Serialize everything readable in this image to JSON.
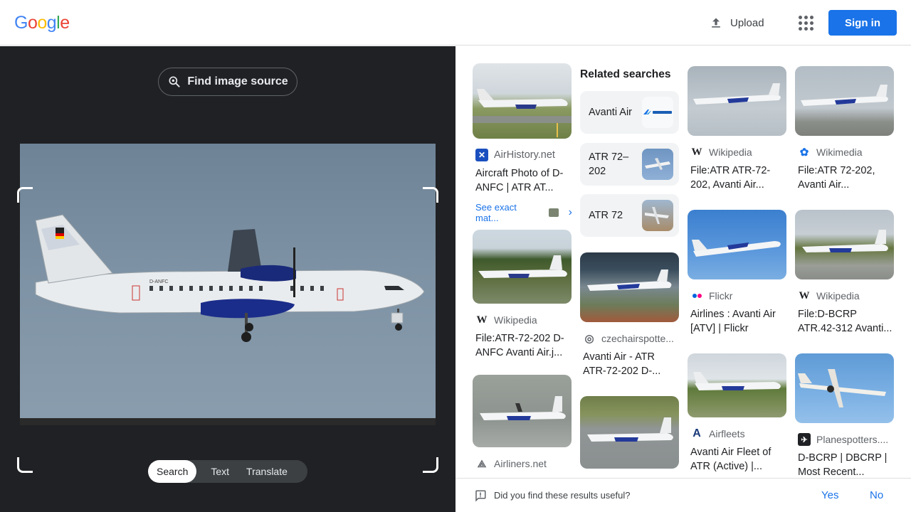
{
  "header": {
    "logo_letters": [
      "G",
      "o",
      "o",
      "g",
      "l",
      "e"
    ],
    "logo_colors": [
      "#4285f4",
      "#ea4335",
      "#fbbc05",
      "#4285f4",
      "#34a853",
      "#ea4335"
    ],
    "upload_label": "Upload",
    "signin_label": "Sign in"
  },
  "left": {
    "find_source_label": "Find image source",
    "tabs": [
      {
        "label": "Search",
        "active": true
      },
      {
        "label": "Text",
        "active": false
      },
      {
        "label": "Translate",
        "active": false
      }
    ],
    "plane_registration": "D-ANFC"
  },
  "related": {
    "title": "Related searches",
    "chips": [
      {
        "label": "Avanti Air"
      },
      {
        "label": "ATR 72–202"
      },
      {
        "label": "ATR 72"
      }
    ]
  },
  "results": [
    {
      "source": "AirHistory.net",
      "title": "Aircraft Photo of D-ANFC | ATR AT..."
    },
    {
      "source": "Wikipedia",
      "title": "File:ATR-72-202 D-ANFC Avanti Air.j..."
    },
    {
      "source": "Airliners.net",
      "title": ""
    },
    {
      "source": "czechairspotte...",
      "title": "Avanti Air - ATR ATR-72-202 D-..."
    },
    {
      "source": "",
      "title": ""
    },
    {
      "source": "Wikipedia",
      "title": "File:ATR ATR-72-202, Avanti Air..."
    },
    {
      "source": "Flickr",
      "title": "Airlines : Avanti Air [ATV] | Flickr"
    },
    {
      "source": "Airfleets",
      "title": "Avanti Air Fleet of ATR (Active) |..."
    },
    {
      "source": "Wikimedia",
      "title": "File:ATR 72-202, Avanti Air..."
    },
    {
      "source": "Wikipedia",
      "title": "File:D-BCRP ATR.42-312 Avanti..."
    },
    {
      "source": "Planespotters....",
      "title": "D-BCRP | DBCRP | Most Recent..."
    }
  ],
  "see_exact": "See exact mat...",
  "feedback": {
    "question": "Did you find these results useful?",
    "yes": "Yes",
    "no": "No"
  },
  "colors": {
    "accent": "#1a73e8",
    "dark_bg": "#202124"
  }
}
